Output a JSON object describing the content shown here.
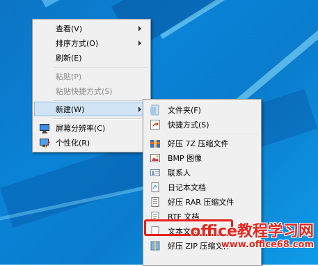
{
  "main_menu": {
    "items": [
      {
        "label": "查看(V)",
        "has_submenu": true
      },
      {
        "label": "排序方式(O)",
        "has_submenu": true
      },
      {
        "label": "刷新(E)"
      },
      {
        "label": "粘贴(P)",
        "disabled": true
      },
      {
        "label": "粘贴快捷方式(S)",
        "disabled": true
      },
      {
        "label": "新建(W)",
        "has_submenu": true,
        "active": true
      },
      {
        "label": "屏幕分辨率(C)",
        "icon": "monitor-icon"
      },
      {
        "label": "个性化(R)",
        "icon": "personalize-icon"
      }
    ]
  },
  "new_submenu": {
    "items": [
      {
        "label": "文件夹(F)",
        "icon": "folder-icon"
      },
      {
        "label": "快捷方式(S)",
        "icon": "shortcut-icon"
      },
      {
        "label": "好压 7Z 压缩文件",
        "icon": "archive-7z-icon"
      },
      {
        "label": "BMP 图像",
        "icon": "bmp-image-icon"
      },
      {
        "label": "联系人",
        "icon": "contact-icon"
      },
      {
        "label": "日记本文档",
        "icon": "journal-icon"
      },
      {
        "label": "好压 RAR 压缩文件",
        "icon": "archive-rar-icon"
      },
      {
        "label": "RTF 文档",
        "icon": "rtf-document-icon"
      },
      {
        "label": "文本文档",
        "icon": "text-document-icon",
        "highlighted": true
      },
      {
        "label": "好压 ZIP 压缩文件",
        "icon": "archive-zip-icon"
      }
    ]
  },
  "watermark": {
    "title": "office教程学习网",
    "url": "www.office68.com"
  },
  "colors": {
    "desktop": "#0a83d6",
    "menu_bg": "#f0f0f0",
    "highlight_border": "#e8201a",
    "active_item": "#d1e4f5"
  }
}
